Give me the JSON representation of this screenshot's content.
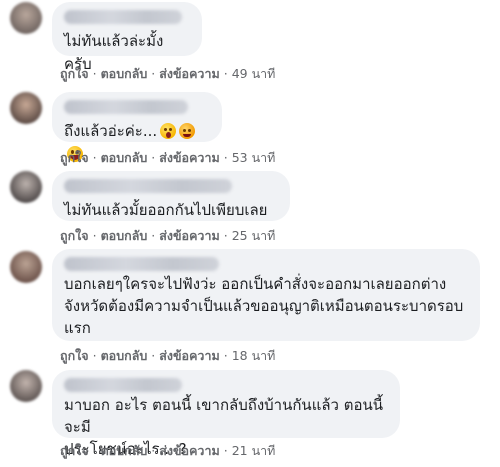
{
  "actions": {
    "like": "ถูกใจ",
    "reply": "ตอบกลับ",
    "message": "ส่งข้อความ",
    "separator": "·"
  },
  "comments": [
    {
      "author_visible": "",
      "text": "ไม่ทันแล้วล่ะมั้งครับ",
      "time": "49 นาที"
    },
    {
      "author_visible": "",
      "text": "ถึงแล้วอ่ะค่ะ...",
      "emojis": [
        "astonished-face-icon",
        "flushed-face-icon",
        "grinning-face-icon"
      ],
      "time": "53 นาที"
    },
    {
      "author_visible": "",
      "text": "ไม่ทันแล้วมั้ยออกกันไปเพียบเลย",
      "time": "25 นาที"
    },
    {
      "author_visible": "",
      "text": "บอกเลยๆใครจะไปฟังว่ะ ออกเป็นคำสั่งจะออกมาเลยออกต่าง\nจังหวัดต้องมีความจำเป็นแล้วขออนุญาติเหมือนตอนระบาดรอบ\nแรก",
      "time": "18 นาที"
    },
    {
      "author_visible": "",
      "text": "มาบอก อะไร ตอนนี้ เขากลับถึงบ้านกันแล้ว ตอนนี้ จะมี\nประโยชน์อะไร....?",
      "time": "21 นาที"
    }
  ]
}
